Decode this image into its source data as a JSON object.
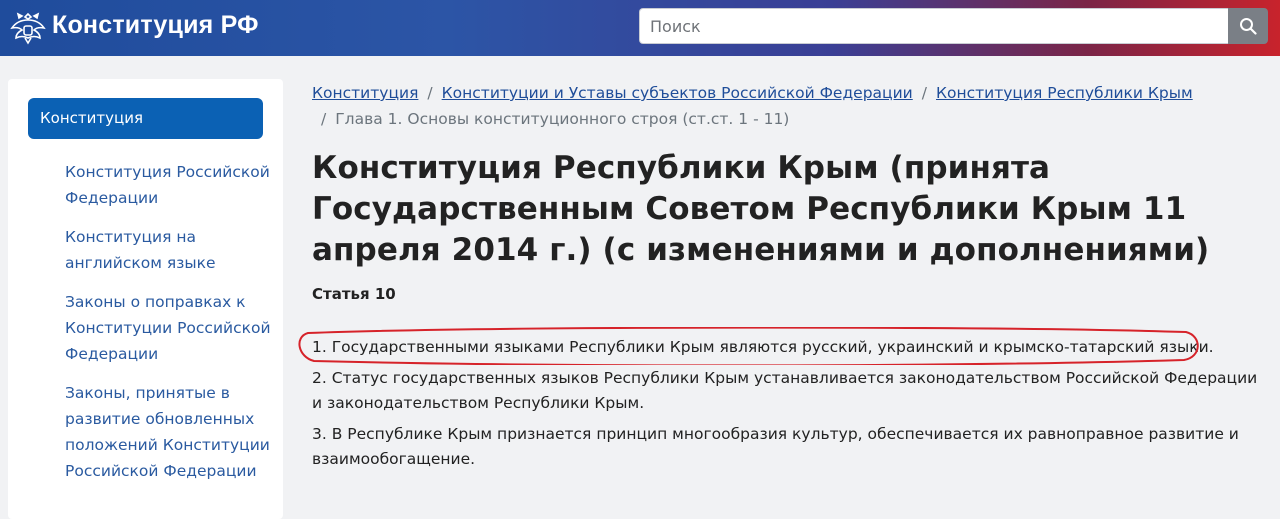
{
  "header": {
    "site_title": "Конституция РФ",
    "emblem_icon": "double-headed-eagle-icon",
    "search": {
      "placeholder": "Поиск",
      "button_icon": "search-icon"
    },
    "gradient_colors": [
      "#1f4c9c",
      "#3a3f95",
      "#c8232c"
    ]
  },
  "sidebar": {
    "active_item": "Конституция",
    "items": [
      {
        "label": "Конституция Российской Федерации"
      },
      {
        "label": "Конституция на английском языке"
      },
      {
        "label": "Законы о поправках к Конституции Российской Федерации"
      },
      {
        "label": "Законы, принятые в развитие обновленных положений Конституции Российской Федерации"
      }
    ]
  },
  "breadcrumb": {
    "links": [
      "Конституция",
      "Конституции и Уставы субъектов Российской Федерации",
      "Конституция Республики Крым"
    ],
    "current": "Глава 1. Основы конституционного строя (ст.ст. 1 - 11)"
  },
  "page": {
    "title": "Конституция Республики Крым (принята Государственным Советом Республики Крым 11 апреля 2014 г.) (с изменениями и дополнениями)",
    "article": "Статья 10",
    "paragraphs": [
      "1. Государственными языками Республики Крым являются русский, украинский и крымско-татарский языки.",
      "2. Статус государственных языков Республики Крым устанавливается законодательством Российской Федерации и законодательством Республики Крым.",
      "3. В Республике Крым признается принцип многообразия культур, обеспечивается их равноправное развитие и взаимообогащение."
    ],
    "highlight_color": "#d6232a"
  }
}
